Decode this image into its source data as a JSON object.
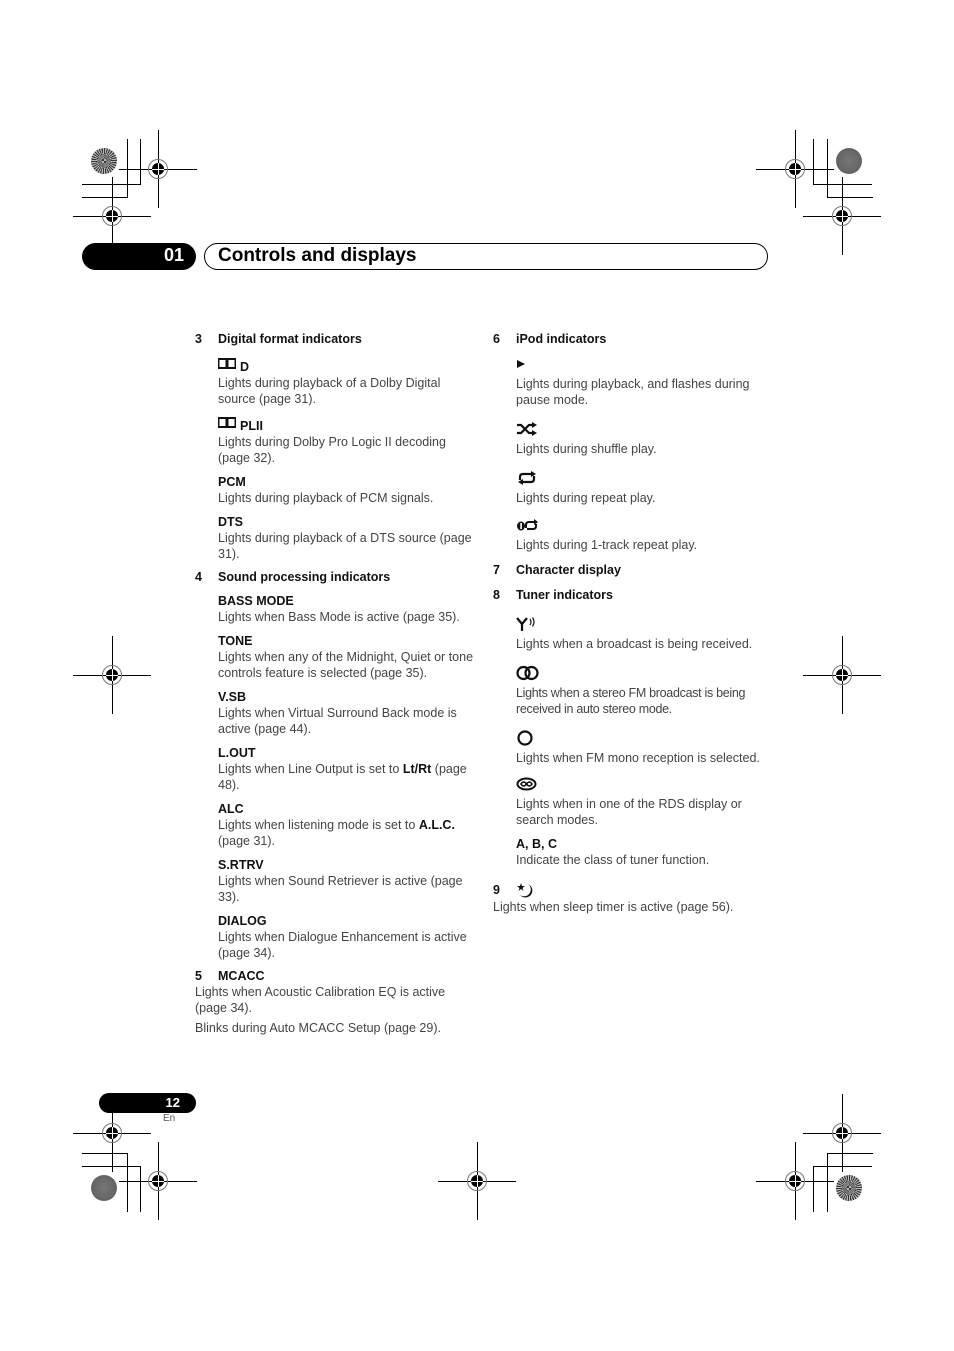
{
  "header": {
    "chapter_number": "01",
    "chapter_title": "Controls and displays"
  },
  "left_column": {
    "sections": [
      {
        "number": "3",
        "title": "Digital format indicators",
        "items": [
          {
            "icon": "dolby-double-d-icon",
            "label": "D",
            "desc": "Lights during playback of a Dolby Digital source (page 31)."
          },
          {
            "icon": "dolby-double-d-icon",
            "label": "PLII",
            "desc": "Lights during Dolby Pro Logic II decoding (page 32)."
          },
          {
            "label": "PCM",
            "desc": "Lights during playback of PCM signals."
          },
          {
            "label": "DTS",
            "desc": "Lights during playback of a DTS source (page 31)."
          }
        ]
      },
      {
        "number": "4",
        "title": "Sound processing indicators",
        "items": [
          {
            "label": "BASS MODE",
            "desc": "Lights when Bass Mode is active (page 35)."
          },
          {
            "label": "TONE",
            "desc": "Lights when any of the Midnight, Quiet or tone controls feature is selected (page 35)."
          },
          {
            "label": "V.SB",
            "desc": "Lights when Virtual Surround Back mode is active (page 44)."
          },
          {
            "label": "L.OUT",
            "desc_pre": "Lights when Line Output is set to ",
            "desc_bold": "Lt/Rt",
            "desc_post": " (page 48)."
          },
          {
            "label": "ALC",
            "desc_pre": "Lights when listening mode is set to ",
            "desc_bold": "A.L.C.",
            "desc_post": " (page 31)."
          },
          {
            "label": "S.RTRV",
            "desc": "Lights when Sound Retriever is active (page 33)."
          },
          {
            "label": "DIALOG",
            "desc": "Lights when Dialogue Enhancement is active (page 34)."
          }
        ]
      },
      {
        "number": "5",
        "title": "MCACC",
        "paragraphs": [
          "Lights when Acoustic Calibration EQ is active (page 34).",
          "Blinks during Auto MCACC Setup (page 29)."
        ]
      }
    ]
  },
  "right_column": {
    "sections": [
      {
        "number": "6",
        "title": "iPod indicators",
        "items": [
          {
            "icon": "play-icon",
            "desc": "Lights during playback, and flashes during pause mode."
          },
          {
            "icon": "shuffle-icon",
            "desc": "Lights during shuffle play."
          },
          {
            "icon": "repeat-icon",
            "desc": "Lights during repeat play."
          },
          {
            "icon": "repeat-one-icon",
            "desc": "Lights during 1-track repeat play."
          }
        ]
      },
      {
        "number": "7",
        "title": "Character display"
      },
      {
        "number": "8",
        "title": "Tuner indicators",
        "items": [
          {
            "icon": "antenna-signal-icon",
            "desc": "Lights when a broadcast is being received."
          },
          {
            "icon": "stereo-icon",
            "desc": "Lights when a stereo FM broadcast is being received in auto stereo mode."
          },
          {
            "icon": "mono-icon",
            "desc": "Lights when FM mono reception is selected."
          },
          {
            "icon": "rds-icon",
            "desc": "Lights when in one of the RDS display or search modes."
          },
          {
            "label": "A, B, C",
            "desc": "Indicate the class of tuner function."
          }
        ]
      },
      {
        "number": "9",
        "icon": "sleep-timer-icon",
        "paragraphs": [
          "Lights when sleep timer is active (page 56)."
        ]
      }
    ]
  },
  "footer": {
    "page_number": "12",
    "language": "En"
  }
}
